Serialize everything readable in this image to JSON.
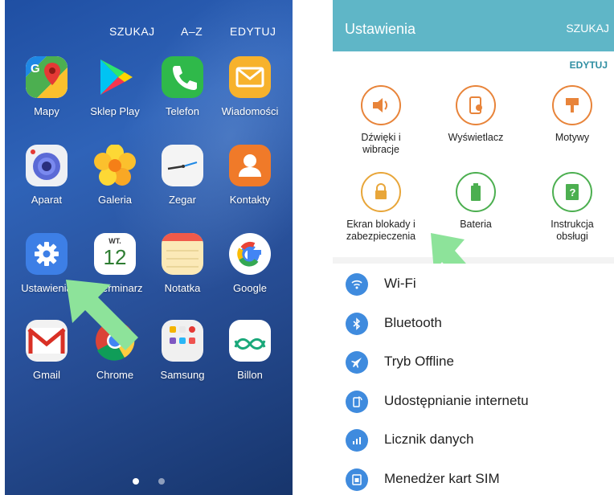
{
  "home": {
    "top_actions": [
      "SZUKAJ",
      "A–Z",
      "EDYTUJ"
    ],
    "apps": [
      {
        "label": "Mapy",
        "icon": "maps-icon"
      },
      {
        "label": "Sklep Play",
        "icon": "play-store-icon"
      },
      {
        "label": "Telefon",
        "icon": "phone-icon"
      },
      {
        "label": "Wiadomości",
        "icon": "messages-icon"
      },
      {
        "label": "Aparat",
        "icon": "camera-icon"
      },
      {
        "label": "Galeria",
        "icon": "gallery-icon"
      },
      {
        "label": "Zegar",
        "icon": "clock-icon"
      },
      {
        "label": "Kontakty",
        "icon": "contacts-icon"
      },
      {
        "label": "Ustawienia",
        "icon": "settings-icon"
      },
      {
        "label": "S Terminarz",
        "icon": "calendar-icon"
      },
      {
        "label": "Notatka",
        "icon": "notes-icon"
      },
      {
        "label": "Google",
        "icon": "google-icon"
      },
      {
        "label": "Gmail",
        "icon": "gmail-icon"
      },
      {
        "label": "Chrome",
        "icon": "chrome-icon"
      },
      {
        "label": "Samsung",
        "icon": "samsung-folder-icon"
      },
      {
        "label": "Billon",
        "icon": "billon-icon"
      }
    ],
    "calendar_icon_text": {
      "weekday": "WT.",
      "day": "12"
    }
  },
  "settings": {
    "title": "Ustawienia",
    "search": "SZUKAJ",
    "edit": "EDYTUJ",
    "quick": [
      {
        "label": "Dźwięki i wibracje",
        "icon": "volume-icon",
        "color": "#e8843a"
      },
      {
        "label": "Wyświetlacz",
        "icon": "display-icon",
        "color": "#e8843a"
      },
      {
        "label": "Motywy",
        "icon": "themes-icon",
        "color": "#e8843a"
      },
      {
        "label": "Ekran blokady i zabezpieczenia",
        "icon": "lock-icon",
        "color": "#e8a63a"
      },
      {
        "label": "Bateria",
        "icon": "battery-icon",
        "color": "#4caf50"
      },
      {
        "label": "Instrukcja obsługi",
        "icon": "manual-icon",
        "color": "#4caf50"
      }
    ],
    "list": [
      {
        "label": "Wi-Fi",
        "icon": "wifi-icon"
      },
      {
        "label": "Bluetooth",
        "icon": "bluetooth-icon"
      },
      {
        "label": "Tryb Offline",
        "icon": "airplane-icon"
      },
      {
        "label": "Udostępnianie internetu",
        "icon": "hotspot-icon"
      },
      {
        "label": "Licznik danych",
        "icon": "data-usage-icon"
      },
      {
        "label": "Menedżer kart SIM",
        "icon": "sim-manager-icon"
      }
    ]
  },
  "colors": {
    "settings_header": "#5fb6c7",
    "list_icon": "#3f8bde",
    "arrow": "#8de39a"
  }
}
